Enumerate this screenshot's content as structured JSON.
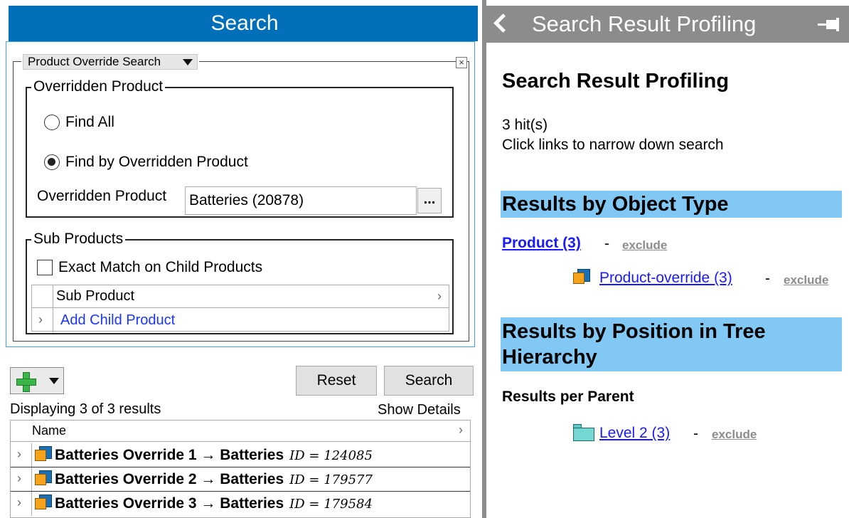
{
  "left": {
    "title": "Search",
    "search_type": "Product Override Search",
    "close_symbol": "×",
    "overridden_group": {
      "legend": "Overridden Product",
      "radio_find_all": "Find All",
      "radio_find_by": "Find by Overridden Product",
      "radio_selected": "Find by Overridden Product",
      "field_label": "Overridden Product",
      "field_value": "Batteries (20878)",
      "browse_label": "..."
    },
    "sub_products_group": {
      "legend": "Sub Products",
      "checkbox_label": "Exact Match on Child Products",
      "checkbox_checked": false,
      "column_header": "Sub Product",
      "add_link": "Add Child Product"
    },
    "toolbar": {
      "reset_label": "Reset",
      "search_label": "Search"
    },
    "status": "Displaying 3 of 3 results",
    "show_details": "Show Details",
    "results": {
      "column_header": "Name",
      "rows": [
        {
          "name": "Batteries Override 1 → Batteries",
          "id": "ID = 124085"
        },
        {
          "name": "Batteries Override 2 → Batteries",
          "id": "ID = 179577"
        },
        {
          "name": "Batteries Override 3 → Batteries",
          "id": "ID = 179584"
        }
      ]
    }
  },
  "right": {
    "title": "Search Result Profiling",
    "heading": "Search Result Profiling",
    "hits": "3 hit(s)",
    "hint": "Click links to narrow down search",
    "section_object_type": "Results by Object Type",
    "object_type_link": "Product (3)",
    "object_subtype_link": "Product-override (3)",
    "dash": "-",
    "exclude_label": "exclude",
    "section_tree_line1": "Results by Position in Tree",
    "section_tree_line2": "Hierarchy",
    "results_per_parent": "Results per Parent",
    "parent_link": "Level 2 (3)"
  },
  "colors": {
    "left_titlebar": "#006fba",
    "right_titlebar": "#8c8c8c",
    "section_band": "#82c8f5",
    "link": "#1a1aff",
    "exclude": "#8c8c8c"
  }
}
